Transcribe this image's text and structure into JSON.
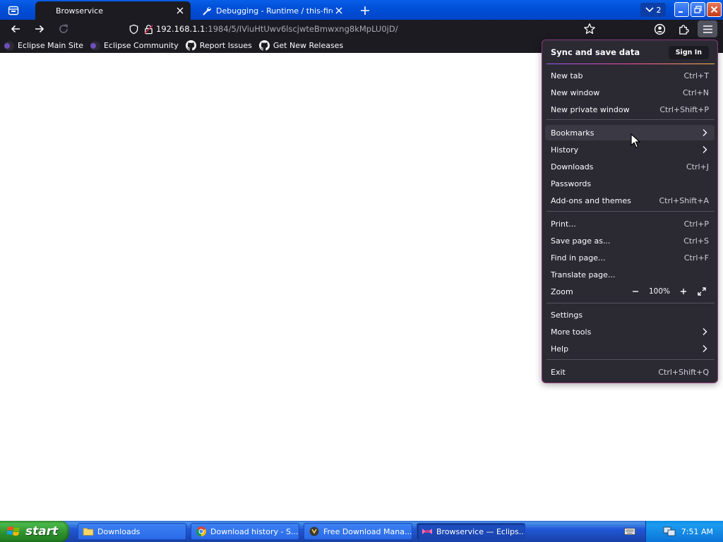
{
  "tabs": [
    {
      "label": "Browservice",
      "active": true
    },
    {
      "label": "Debugging - Runtime / this-firefox",
      "active": false
    }
  ],
  "tab_count": "2",
  "url": {
    "host": "192.168.1.1",
    "path": ":1984/5/IViuHtUwv6lscjwteBmwxng8kMpLU0jD/"
  },
  "bookmarks": [
    {
      "label": "Eclipse Main Site",
      "icon": "eclipse-icon"
    },
    {
      "label": "Eclipse Community",
      "icon": "eclipse-icon"
    },
    {
      "label": "Report Issues",
      "icon": "github-icon"
    },
    {
      "label": "Get New Releases",
      "icon": "github-icon"
    }
  ],
  "app_menu": {
    "header": "Sync and save data",
    "sign_in": "Sign In",
    "items": [
      {
        "label": "New tab",
        "shortcut": "Ctrl+T"
      },
      {
        "label": "New window",
        "shortcut": "Ctrl+N"
      },
      {
        "label": "New private window",
        "shortcut": "Ctrl+Shift+P"
      },
      {
        "label": "Bookmarks",
        "shortcut": ""
      },
      {
        "label": "History",
        "shortcut": ""
      },
      {
        "label": "Downloads",
        "shortcut": "Ctrl+J"
      },
      {
        "label": "Passwords",
        "shortcut": ""
      },
      {
        "label": "Add-ons and themes",
        "shortcut": "Ctrl+Shift+A"
      },
      {
        "label": "Print...",
        "shortcut": "Ctrl+P"
      },
      {
        "label": "Save page as...",
        "shortcut": "Ctrl+S"
      },
      {
        "label": "Find in page...",
        "shortcut": "Ctrl+F"
      },
      {
        "label": "Translate page...",
        "shortcut": ""
      },
      {
        "label": "Zoom",
        "shortcut": ""
      },
      {
        "label": "Settings",
        "shortcut": ""
      },
      {
        "label": "More tools",
        "shortcut": ""
      },
      {
        "label": "Help",
        "shortcut": ""
      },
      {
        "label": "Exit",
        "shortcut": "Ctrl+Shift+Q"
      }
    ],
    "zoom_value": "100%"
  },
  "taskbar": {
    "start": "start",
    "buttons": [
      {
        "label": "Downloads",
        "icon": "folder-icon"
      },
      {
        "label": "Download history - S...",
        "icon": "chrome-icon"
      },
      {
        "label": "Free Download Mana...",
        "icon": "fdm-icon"
      },
      {
        "label": "Browservice — Eclips...",
        "icon": "browservice-icon"
      }
    ],
    "clock": "7:51 AM"
  },
  "colors": {
    "toolbar": "#1c1b22",
    "menu_bg": "#2b2a33",
    "xp_blue": "#0050d8",
    "start_green": "#3c9a3c"
  }
}
